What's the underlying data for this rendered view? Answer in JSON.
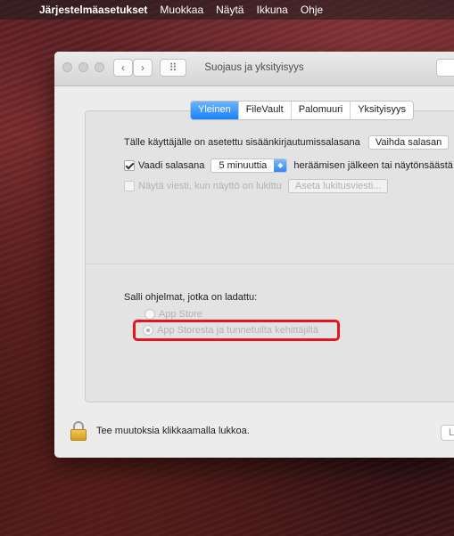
{
  "menubar": {
    "apple_icon": "apple-logo",
    "app_name": "Järjestelmäasetukset",
    "items": [
      "Muokkaa",
      "Näytä",
      "Ikkuna",
      "Ohje"
    ]
  },
  "window": {
    "title": "Suojaus ja yksityisyys",
    "nav_back": "‹",
    "nav_forward": "›",
    "grid_icon": "⠿"
  },
  "tabs": [
    {
      "label": "Yleinen",
      "active": true
    },
    {
      "label": "FileVault",
      "active": false
    },
    {
      "label": "Palomuuri",
      "active": false
    },
    {
      "label": "Yksityisyys",
      "active": false
    }
  ],
  "general": {
    "password_set_text": "Tälle käyttäjälle on asetettu sisäänkirjautumissalasana",
    "change_password_button": "Vaihda salasan",
    "require_password": {
      "checked": true,
      "label": "Vaadi salasana",
      "delay_value": "5 minuuttia",
      "suffix": "heräämisen jälkeen tai näytönsäästä"
    },
    "show_message": {
      "checked": false,
      "enabled": false,
      "label": "Näytä viesti, kun näyttö on lukittu",
      "button": "Aseta lukitusviesti..."
    }
  },
  "allow_apps": {
    "heading": "Salli ohjelmat, jotka on ladattu:",
    "options": [
      {
        "label": "App Store",
        "selected": false
      },
      {
        "label": "App Storesta ja tunnetuilta kehittäjiltä",
        "selected": true
      }
    ],
    "highlight_color": "#e8141c"
  },
  "footer": {
    "lock_text": "Tee muutoksia klikkaamalla lukkoa.",
    "advanced_button_partial": "L"
  }
}
